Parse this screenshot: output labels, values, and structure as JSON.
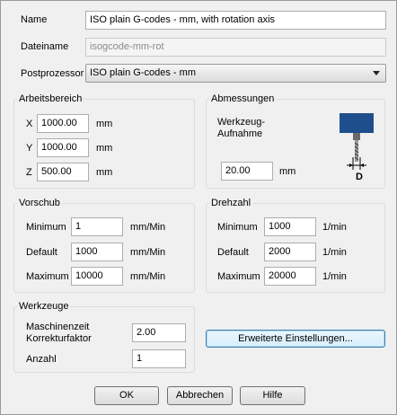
{
  "general": {
    "name_label": "Name",
    "name_value": "ISO plain G-codes - mm, with rotation axis",
    "filename_label": "Dateiname",
    "filename_value": "isogcode-mm-rot",
    "postprocessor_label": "Postprozessor",
    "postprocessor_value": "ISO plain G-codes - mm"
  },
  "work_area": {
    "title": "Arbeitsbereich",
    "x_label": "X",
    "x_value": "1000.00",
    "x_unit": "mm",
    "y_label": "Y",
    "y_value": "1000.00",
    "y_unit": "mm",
    "z_label": "Z",
    "z_value": "500.00",
    "z_unit": "mm"
  },
  "dimensions": {
    "title": "Abmessungen",
    "tool_holder_label_line1": "Werkzeug-",
    "tool_holder_label_line2": "Aufnahme",
    "value": "20.00",
    "unit": "mm",
    "diameter_marker": "D"
  },
  "feed": {
    "title": "Vorschub",
    "min_label": "Minimum",
    "min_value": "1",
    "min_unit": "mm/Min",
    "default_label": "Default",
    "default_value": "1000",
    "default_unit": "mm/Min",
    "max_label": "Maximum",
    "max_value": "10000",
    "max_unit": "mm/Min"
  },
  "speed": {
    "title": "Drehzahl",
    "min_label": "Minimum",
    "min_value": "1000",
    "min_unit": "1/min",
    "default_label": "Default",
    "default_value": "2000",
    "default_unit": "1/min",
    "max_label": "Maximum",
    "max_value": "20000",
    "max_unit": "1/min"
  },
  "tools": {
    "title": "Werkzeuge",
    "machine_time_label_line1": "Maschinenzeit",
    "machine_time_label_line2": "Korrekturfaktor",
    "machine_time_value": "2.00",
    "count_label": "Anzahl",
    "count_value": "1"
  },
  "buttons": {
    "advanced": "Erweiterte Einstellungen...",
    "ok": "OK",
    "cancel": "Abbrechen",
    "help": "Hilfe"
  },
  "colors": {
    "tool_blue": "#1f4e8c",
    "focus_border": "#3c7fb1"
  }
}
